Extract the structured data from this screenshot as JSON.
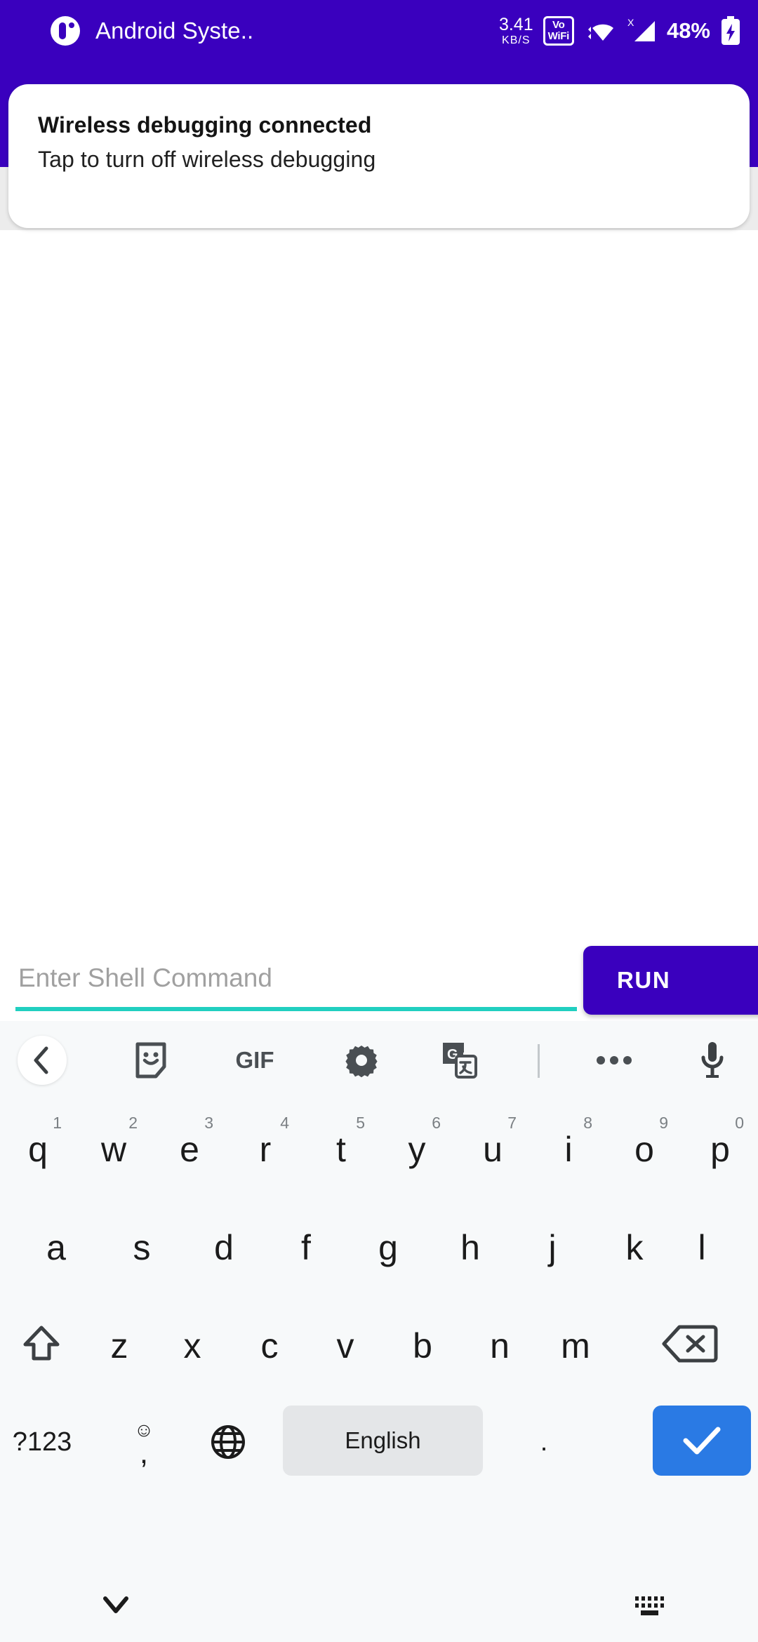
{
  "statusbar": {
    "app_name": "Android Syste..",
    "app_icon": "android-system-icon",
    "net_speed_value": "3.41",
    "net_speed_unit": "KB/S",
    "volte_line1": "Vo",
    "volte_line2": "WiFi",
    "wifi_icon": "wifi-icon",
    "signal_icon": "cellular-signal-no-sim-icon",
    "signal_badge": "X",
    "battery_percent": "48%",
    "battery_icon": "battery-charging-icon",
    "background_color": "#3A00BE"
  },
  "notification": {
    "title": "Wireless debugging connected",
    "subtitle": "Tap to turn off wireless debugging"
  },
  "input": {
    "placeholder": "Enter Shell Command",
    "value": "",
    "underline_color": "#21cfc0",
    "run_label": "RUN",
    "run_color": "#3A00BE"
  },
  "keyboard": {
    "toolbar": [
      {
        "name": "back-icon",
        "label": ""
      },
      {
        "name": "sticker-icon",
        "label": ""
      },
      {
        "name": "gif-icon",
        "label": "GIF"
      },
      {
        "name": "gear-icon",
        "label": ""
      },
      {
        "name": "translate-icon",
        "label": ""
      },
      {
        "name": "more-options-icon",
        "label": ""
      },
      {
        "name": "microphone-icon",
        "label": ""
      }
    ],
    "row1": [
      {
        "ch": "q",
        "num": "1"
      },
      {
        "ch": "w",
        "num": "2"
      },
      {
        "ch": "e",
        "num": "3"
      },
      {
        "ch": "r",
        "num": "4"
      },
      {
        "ch": "t",
        "num": "5"
      },
      {
        "ch": "y",
        "num": "6"
      },
      {
        "ch": "u",
        "num": "7"
      },
      {
        "ch": "i",
        "num": "8"
      },
      {
        "ch": "o",
        "num": "9"
      },
      {
        "ch": "p",
        "num": "0"
      }
    ],
    "row2": [
      {
        "ch": "a"
      },
      {
        "ch": "s"
      },
      {
        "ch": "d"
      },
      {
        "ch": "f"
      },
      {
        "ch": "g"
      },
      {
        "ch": "h"
      },
      {
        "ch": "j"
      },
      {
        "ch": "k"
      },
      {
        "ch": "l"
      }
    ],
    "row3": [
      {
        "ch": "z"
      },
      {
        "ch": "x"
      },
      {
        "ch": "c"
      },
      {
        "ch": "v"
      },
      {
        "ch": "b"
      },
      {
        "ch": "n"
      },
      {
        "ch": "m"
      }
    ],
    "shift_icon": "shift-icon",
    "backspace_icon": "backspace-icon",
    "symbols_label": "?123",
    "emoji_icon": "emoji-icon",
    "comma_label": ",",
    "globe_icon": "globe-language-icon",
    "space_label": "English",
    "period_label": ".",
    "enter_icon": "enter-checkmark-icon",
    "enter_color": "#2a7ae4"
  },
  "navbar": {
    "hide_keyboard_icon": "chevron-down-icon",
    "switch_keyboard_icon": "keyboard-icon"
  }
}
